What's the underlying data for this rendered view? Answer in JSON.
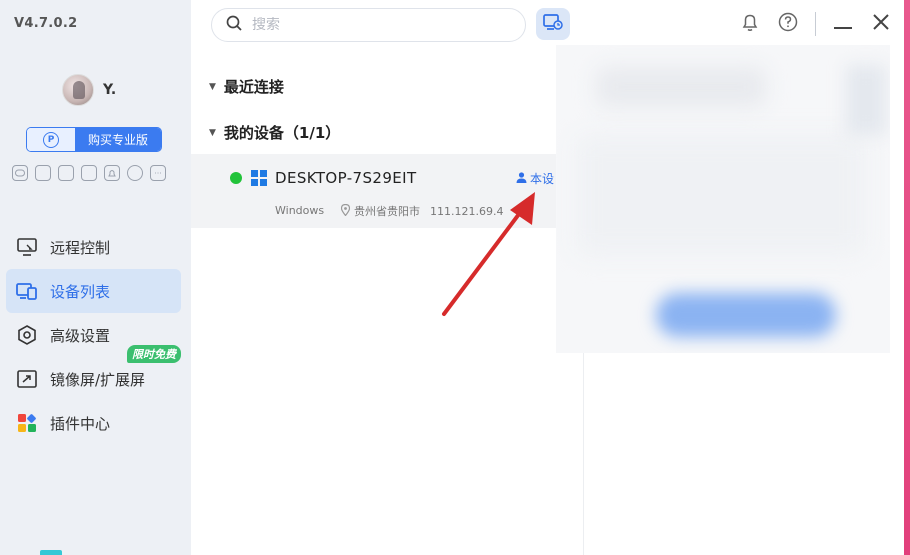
{
  "app": {
    "version": "V4.7.0.2"
  },
  "user": {
    "name": "Y."
  },
  "sidebar": {
    "pro_button": {
      "icon_letter": "P",
      "label": "购买专业版"
    },
    "badge_icons": [
      "gamepad-icon",
      "window-icon",
      "image-icon",
      "copy-icon",
      "bell-icon",
      "circle-icon",
      "more-icon"
    ],
    "badge_more": "···",
    "items": [
      {
        "label": "远程控制",
        "icon": "remote-control-icon"
      },
      {
        "label": "设备列表",
        "icon": "device-list-icon",
        "active": true
      },
      {
        "label": "高级设置",
        "icon": "advanced-settings-icon"
      },
      {
        "label": "镜像屏/扩展屏",
        "icon": "mirror-screen-icon",
        "promo": "限时免费"
      },
      {
        "label": "插件中心",
        "icon": "plugin-center-icon"
      }
    ]
  },
  "search": {
    "placeholder": "搜索"
  },
  "sections": {
    "recent": "最近连接",
    "my_devices": "我的设备（1/1）"
  },
  "device": {
    "name": "DESKTOP-7S29EIT",
    "status": "online",
    "tag": "本设",
    "os": "Windows",
    "location": "贵州省贵阳市",
    "ip": "111.121.69.4"
  },
  "colors": {
    "accent": "#2f6fe8",
    "online": "#22c33a",
    "sidebar_bg": "#edf0f5",
    "active_bg": "#d6e4f7",
    "promo": "#3bbf6f",
    "annotation_arrow": "#d62b2b"
  }
}
